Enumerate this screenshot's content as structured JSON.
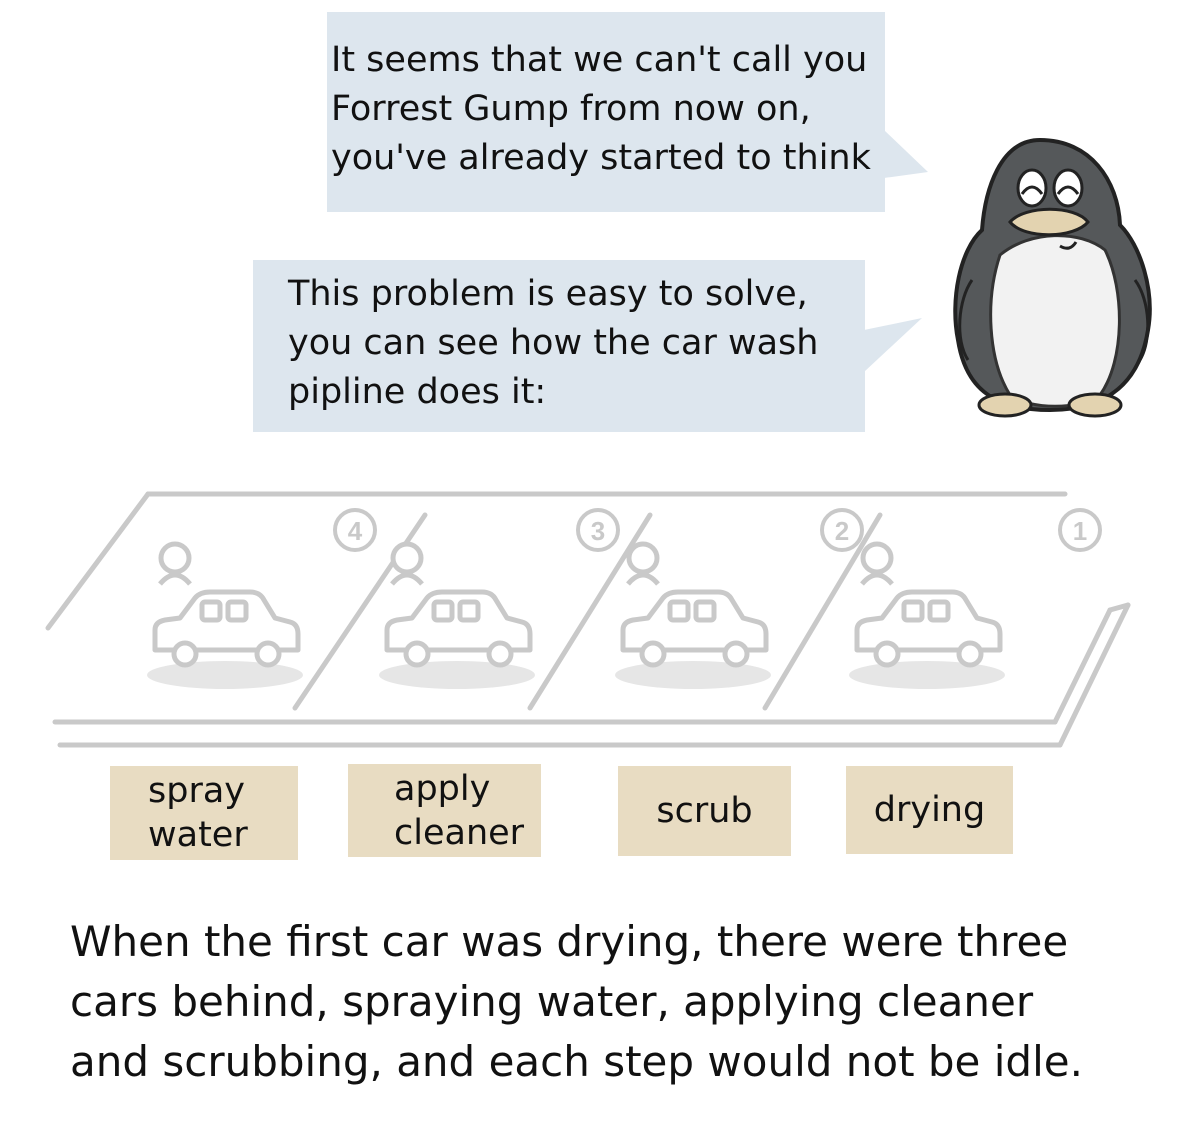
{
  "bubbles": {
    "first": "It seems that we can't call you\nForrest Gump from now on,\nyou've already started to think",
    "second": "This problem is easy to solve,\nyou can see how the car wash\npipline does it:"
  },
  "stage_numbers": [
    "4",
    "3",
    "2",
    "1"
  ],
  "stages": [
    {
      "label": "spray\nwater"
    },
    {
      "label": "apply\ncleaner"
    },
    {
      "label": "scrub"
    },
    {
      "label": "drying"
    }
  ],
  "caption": "When the first car was drying, there were three\ncars behind, spraying water, applying cleaner\nand scrubbing, and each step would not be idle.",
  "colors": {
    "bubble": "#dde6ee",
    "label": "#e8dcc2",
    "line": "#c9c9c9",
    "penguin_body": "#55585a",
    "penguin_belly": "#f2f2f2",
    "penguin_beak": "#e3d3b0"
  }
}
